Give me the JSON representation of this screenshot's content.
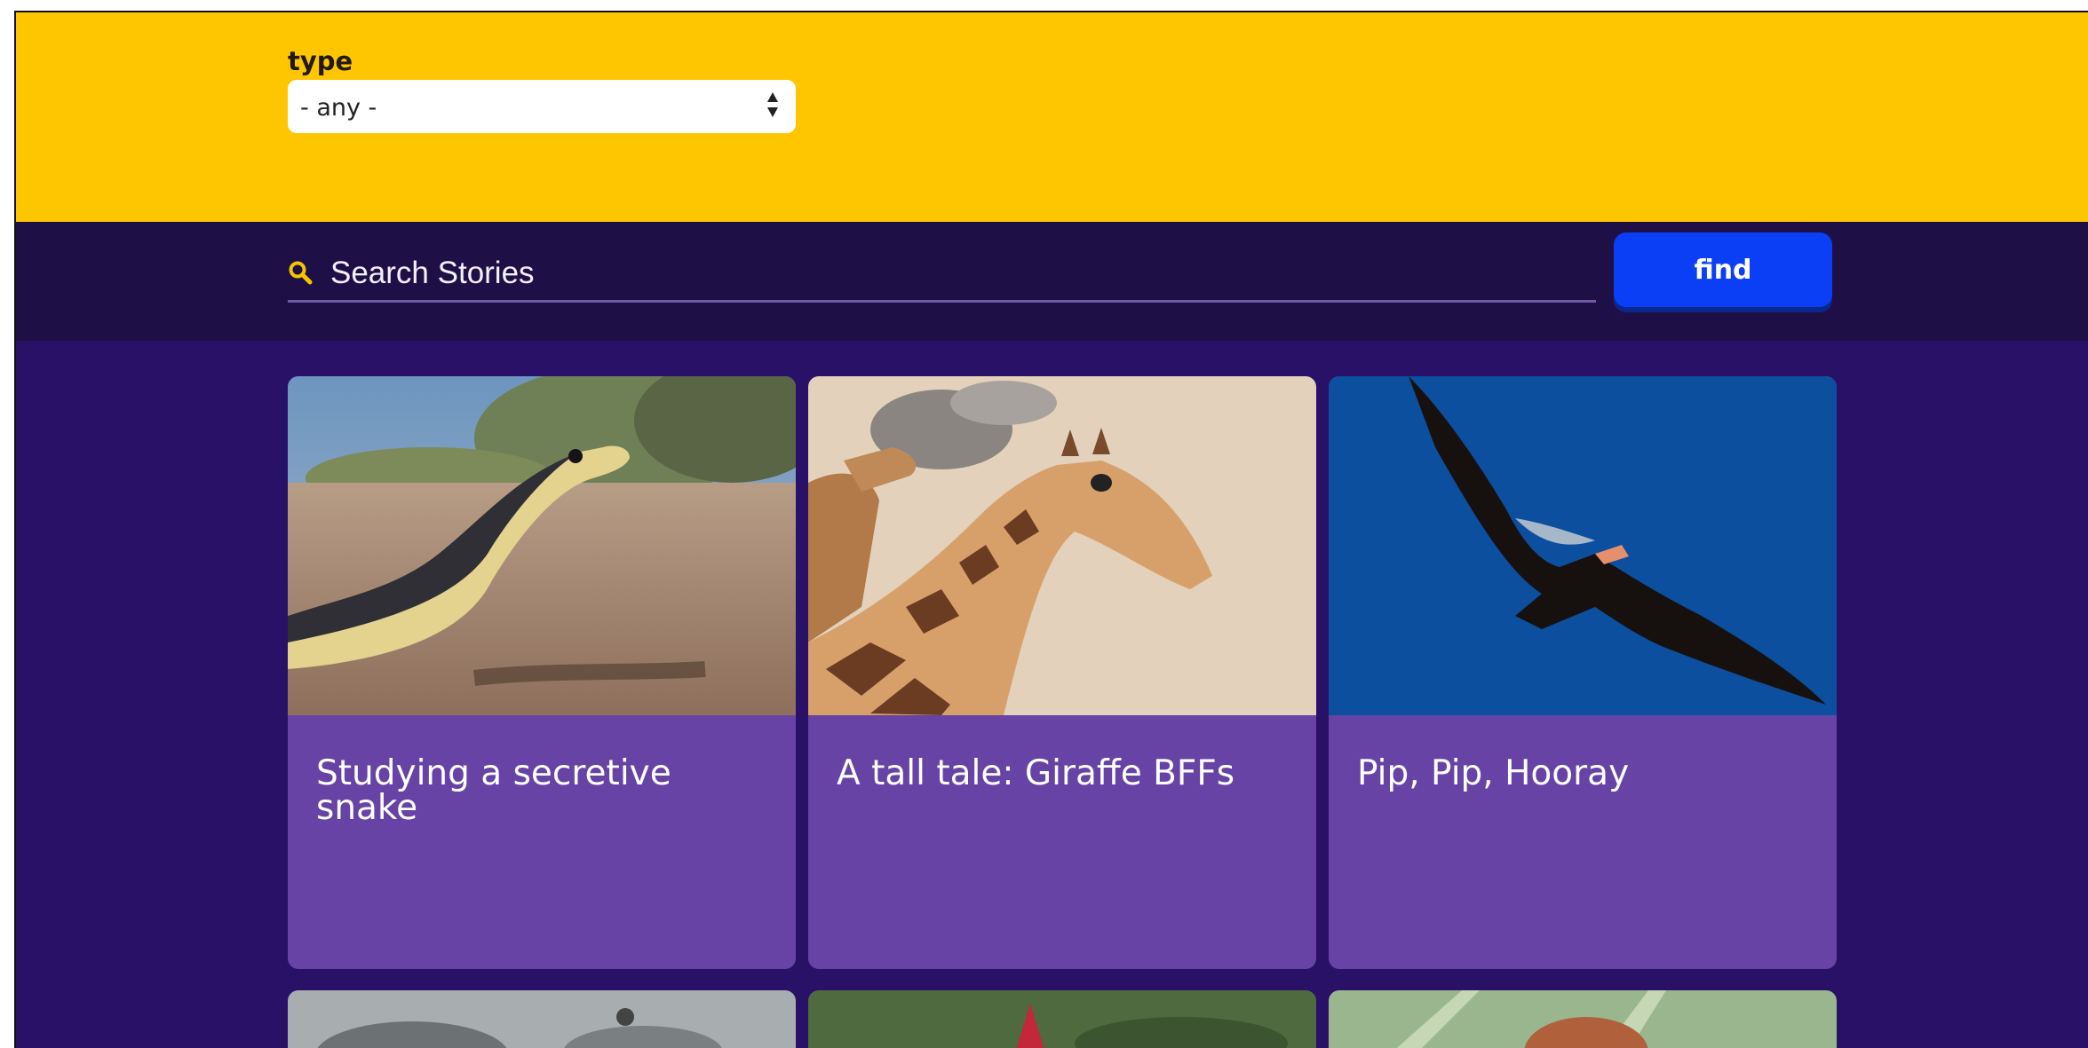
{
  "filter": {
    "type_label": "type",
    "type_value": "- any -"
  },
  "search": {
    "placeholder": "Search Stories",
    "button_label": "find",
    "icon": "search-icon"
  },
  "stories": [
    {
      "title": "Studying a secretive snake",
      "image": "snake-photo"
    },
    {
      "title": "A tall tale: Giraffe BFFs",
      "image": "giraffe-photo"
    },
    {
      "title": "Pip, Pip, Hooray",
      "image": "condor-photo"
    }
  ],
  "colors": {
    "filter_bar": "#fec600",
    "search_bar": "#1e1047",
    "page_bg": "#281166",
    "card_bg": "#6643a5",
    "find_button": "#0a3ff5",
    "search_icon": "#f5c400"
  }
}
